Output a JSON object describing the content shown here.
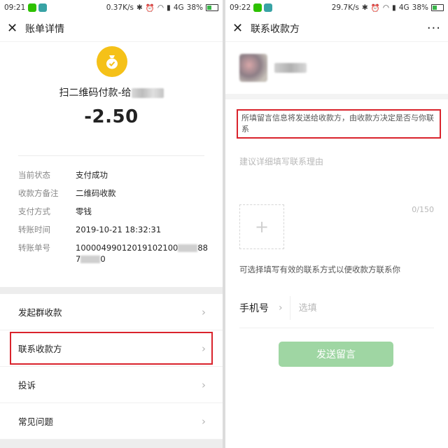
{
  "left": {
    "status": {
      "time": "09:21",
      "net": "0.37K/s",
      "signal": "4G",
      "battery": "38%"
    },
    "nav": {
      "title": "账单详情"
    },
    "bill": {
      "merchant_prefix": "扫二维码付款-给",
      "amount": "-2.50",
      "rows": [
        {
          "key": "当前状态",
          "value": "支付成功"
        },
        {
          "key": "收款方备注",
          "value": "二维码收款"
        },
        {
          "key": "支付方式",
          "value": "零钱"
        },
        {
          "key": "转账时间",
          "value": "2019-10-21 18:32:31"
        },
        {
          "key": "转账单号",
          "value_a": "10000499012019102100",
          "value_b": "88",
          "value_c": "7",
          "value_d": "0"
        }
      ]
    },
    "menu": [
      {
        "label": "发起群收款"
      },
      {
        "label": "联系收款方"
      },
      {
        "label": "投诉"
      },
      {
        "label": "常见问题"
      }
    ]
  },
  "right": {
    "status": {
      "time": "09:22",
      "net": "29.7K/s",
      "signal": "4G",
      "battery": "38%"
    },
    "nav": {
      "title": "联系收款方",
      "more": "···"
    },
    "notice": "所填留言信息将发送给收款方，由收款方决定是否与你联系",
    "reason_placeholder": "建议详细填写联系理由",
    "counter": "0/150",
    "hint": "可选择填写有效的联系方式以便收款方联系你",
    "phone": {
      "label": "手机号",
      "placeholder": "选填"
    },
    "send_button": "发送留言"
  },
  "colors": {
    "highlight": "#d9232c",
    "coin": "#f5c118",
    "button": "#9fd6a3",
    "wechat": "#2dc100"
  }
}
